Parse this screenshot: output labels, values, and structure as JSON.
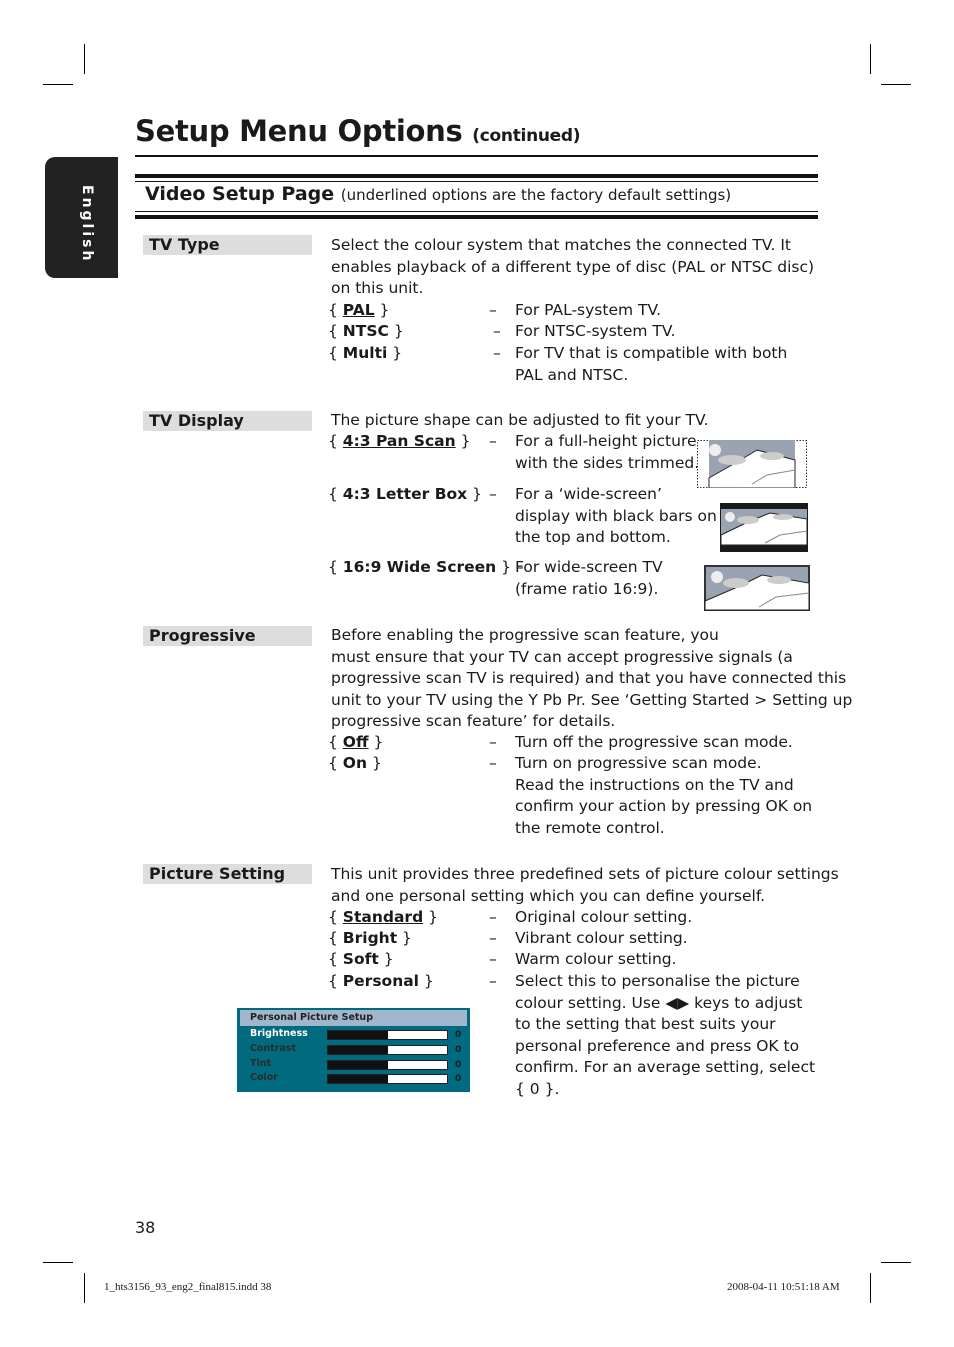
{
  "header": {
    "title": "Setup Menu Options",
    "title_suffix": "(continued)",
    "language_tab": "English"
  },
  "section": {
    "title": "Video Setup Page",
    "note": "(underlined options are the factory default settings)"
  },
  "tv_type": {
    "label": "TV Type",
    "intro_lines": [
      "Select the colour system that matches the connected TV. It",
      "enables playback of a different type of disc (PAL or NTSC disc)",
      "on this unit."
    ],
    "options": [
      {
        "name": "PAL",
        "default": true,
        "desc": [
          "For PAL-system TV."
        ]
      },
      {
        "name": "NTSC",
        "default": false,
        "desc": [
          "For NTSC-system TV."
        ]
      },
      {
        "name": "Multi",
        "default": false,
        "desc": [
          "For TV that is compatible with both",
          "PAL and NTSC."
        ]
      }
    ]
  },
  "tv_display": {
    "label": "TV Display",
    "intro": "The picture shape can be adjusted to fit your TV.",
    "options": [
      {
        "name": "4:3 Pan Scan",
        "default": true,
        "desc": [
          "For a full-height picture",
          "with the sides trimmed."
        ],
        "image": "pan-scan-illustration"
      },
      {
        "name": "4:3 Letter Box",
        "default": false,
        "desc": [
          "For a ‘wide-screen’",
          "display with black bars on",
          "the top and bottom."
        ],
        "image": "letter-box-illustration"
      },
      {
        "name": "16:9 Wide Screen",
        "default": false,
        "desc": [
          "For wide-screen TV",
          "(frame ratio 16:9)."
        ],
        "image": "wide-screen-illustration"
      }
    ]
  },
  "progressive": {
    "label": "Progressive",
    "intro_lines": [
      "Before enabling the progressive scan feature, you",
      "must ensure that your TV can accept progressive signals (a",
      "progressive scan TV is required) and that you have connected this",
      "unit to your TV using the Y Pb Pr. See ‘Getting Started > Setting up",
      "progressive scan feature’ for details."
    ],
    "options": [
      {
        "name": "Off",
        "default": true,
        "desc": [
          "Turn off the progressive scan mode."
        ]
      },
      {
        "name": "On",
        "default": false,
        "desc": [
          "Turn on progressive scan mode.",
          "Read the instructions on the TV and",
          "confirm your action by pressing OK on",
          "the remote control."
        ]
      }
    ]
  },
  "picture_setting": {
    "label": "Picture Setting",
    "intro_lines": [
      "This unit provides three predefined sets of picture colour settings",
      "and one personal setting which you can define yourself."
    ],
    "options": [
      {
        "name": "Standard",
        "default": true,
        "desc": [
          "Original colour setting."
        ]
      },
      {
        "name": "Bright",
        "default": false,
        "desc": [
          "Vibrant colour setting."
        ]
      },
      {
        "name": "Soft",
        "default": false,
        "desc": [
          "Warm colour setting."
        ]
      },
      {
        "name": "Personal",
        "default": false,
        "desc": [
          "Select this to personalise the picture",
          "colour setting. Use ◀▶ keys to adjust",
          "to the setting that best suits your",
          "personal preference and press OK to",
          "confirm. For an average setting, select",
          "{ 0 }."
        ]
      }
    ],
    "personal_setup": {
      "title": "Personal Picture Setup",
      "rows": [
        {
          "name": "Brightness",
          "value": "0",
          "level": 0.5,
          "active": true
        },
        {
          "name": "Contrast",
          "value": "0",
          "level": 0.5,
          "active": false
        },
        {
          "name": "Tint",
          "value": "0",
          "level": 0.5,
          "active": false
        },
        {
          "name": "Color",
          "value": "0",
          "level": 0.5,
          "active": false
        }
      ]
    }
  },
  "footer": {
    "page_number": "38",
    "file_name": "1_hts3156_93_eng2_final815.indd   38",
    "timestamp": "2008-04-11   10:51:18 AM"
  }
}
